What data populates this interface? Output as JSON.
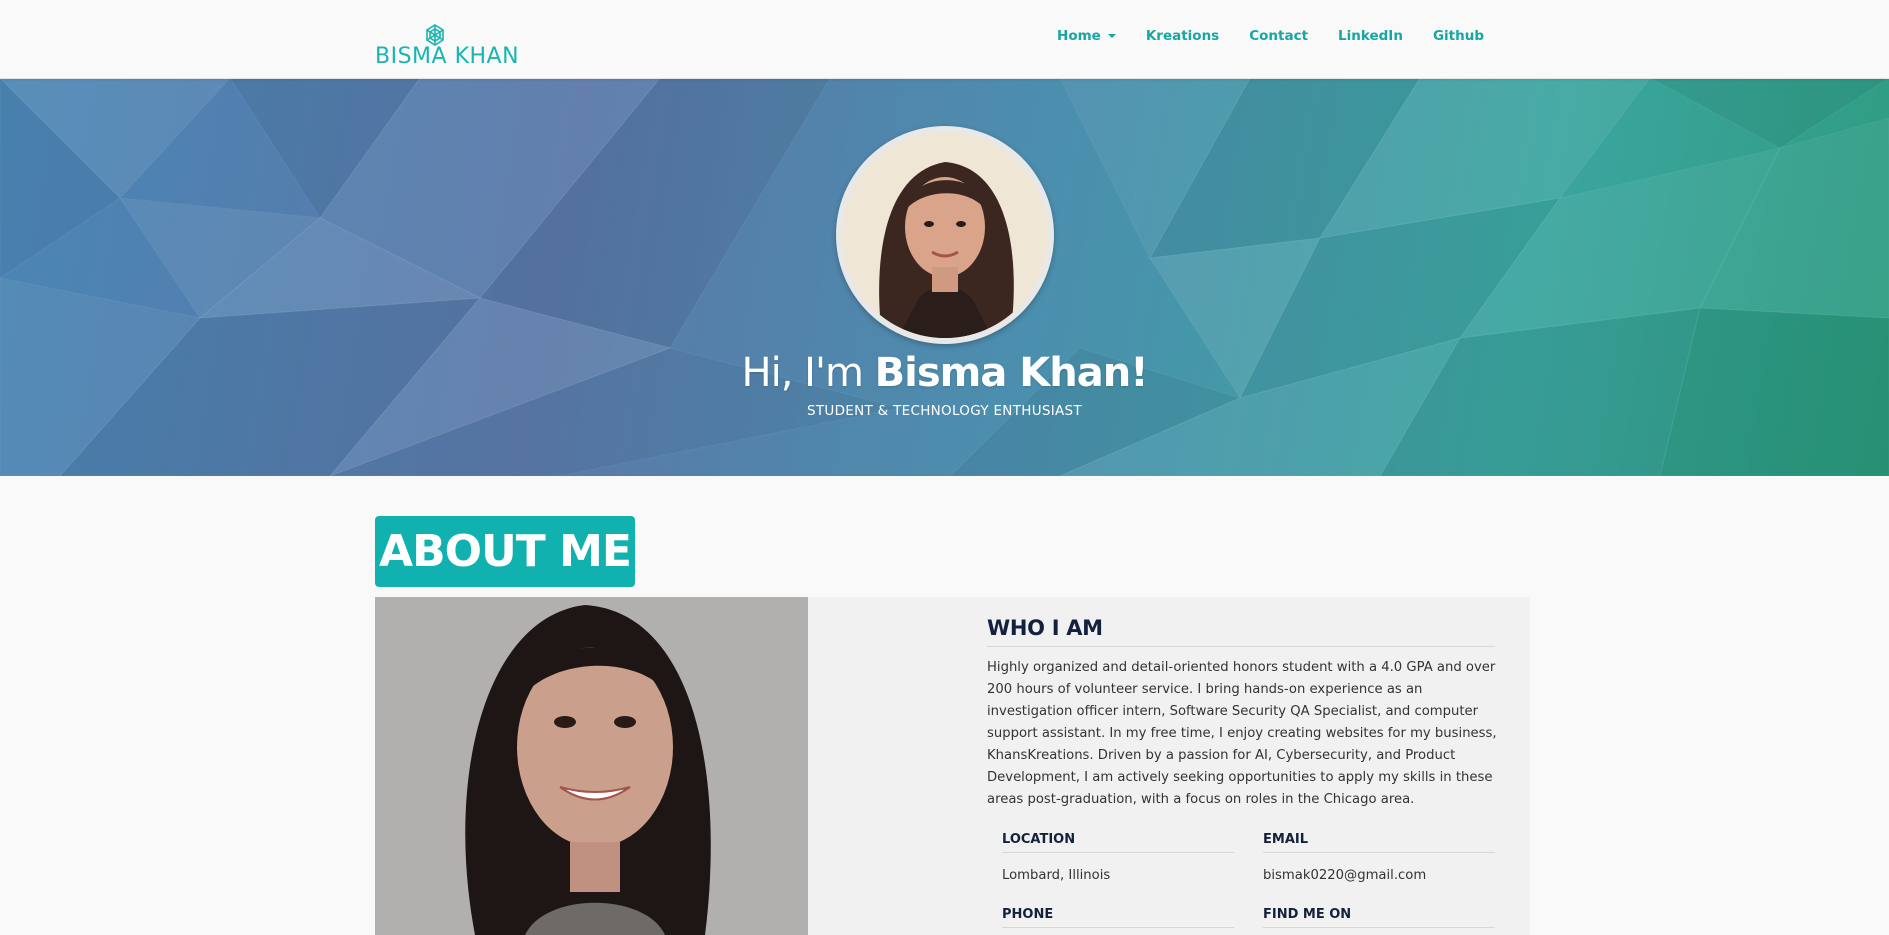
{
  "brand": {
    "logo_text": "BISMA KHAN",
    "logo_icon": "geometric-knot-icon",
    "accent_color": "#1ab5b0"
  },
  "nav": {
    "items": [
      {
        "label": "Home",
        "has_dropdown": true
      },
      {
        "label": "Kreations"
      },
      {
        "label": "Contact"
      },
      {
        "label": "LinkedIn"
      },
      {
        "label": "Github"
      }
    ]
  },
  "hero": {
    "greeting": "Hi, I'm",
    "name": "Bisma Khan!",
    "subtitle": "STUDENT & TECHNOLOGY ENTHUSIAST"
  },
  "about": {
    "heading": "ABOUT ME",
    "who_title": "WHO I AM",
    "bio": "Highly organized and detail-oriented honors student with a 4.0 GPA and over 200 hours of volunteer service. I bring hands-on experience as an investigation officer intern, Software Security QA Specialist, and computer support assistant. In my free time, I enjoy creating websites for my business, KhansKreations. Driven by a passion for AI, Cybersecurity, and Product Development, I am actively seeking opportunities to apply my skills in these areas post-graduation, with a focus on roles in the Chicago area.",
    "location_label": "LOCATION",
    "location_value": "Lombard, Illinois",
    "email_label": "EMAIL",
    "email_value": "bismak0220@gmail.com",
    "phone_label": "PHONE",
    "find_label": "FIND ME ON"
  }
}
